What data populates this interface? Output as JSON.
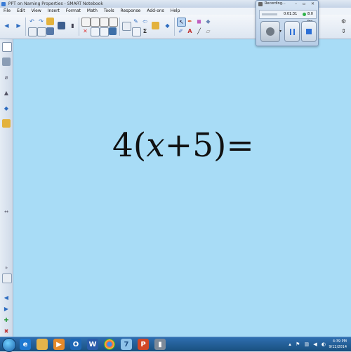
{
  "window": {
    "title": "PPT on Naming Properties - SMART Notebook"
  },
  "menu": [
    "File",
    "Edit",
    "View",
    "Insert",
    "Format",
    "Math",
    "Tools",
    "Response",
    "Add-ons",
    "Help"
  ],
  "canvas": {
    "equation": {
      "prefix": "4(",
      "var": "x",
      "suffix": "+5)="
    },
    "background_color": "#a8dcf6"
  },
  "recorder": {
    "title": "Recording...",
    "elapsed": "0:01:31",
    "fps": "8.0 fps"
  },
  "taskbar": {
    "time": "4:39 PM",
    "date": "9/12/2014",
    "apps": [
      "internet-explorer-icon",
      "file-explorer-icon",
      "media-player-icon",
      "outlook-icon",
      "word-icon",
      "chrome-icon",
      "smart-notebook-icon",
      "powerpoint-icon",
      "recorder-icon"
    ]
  }
}
